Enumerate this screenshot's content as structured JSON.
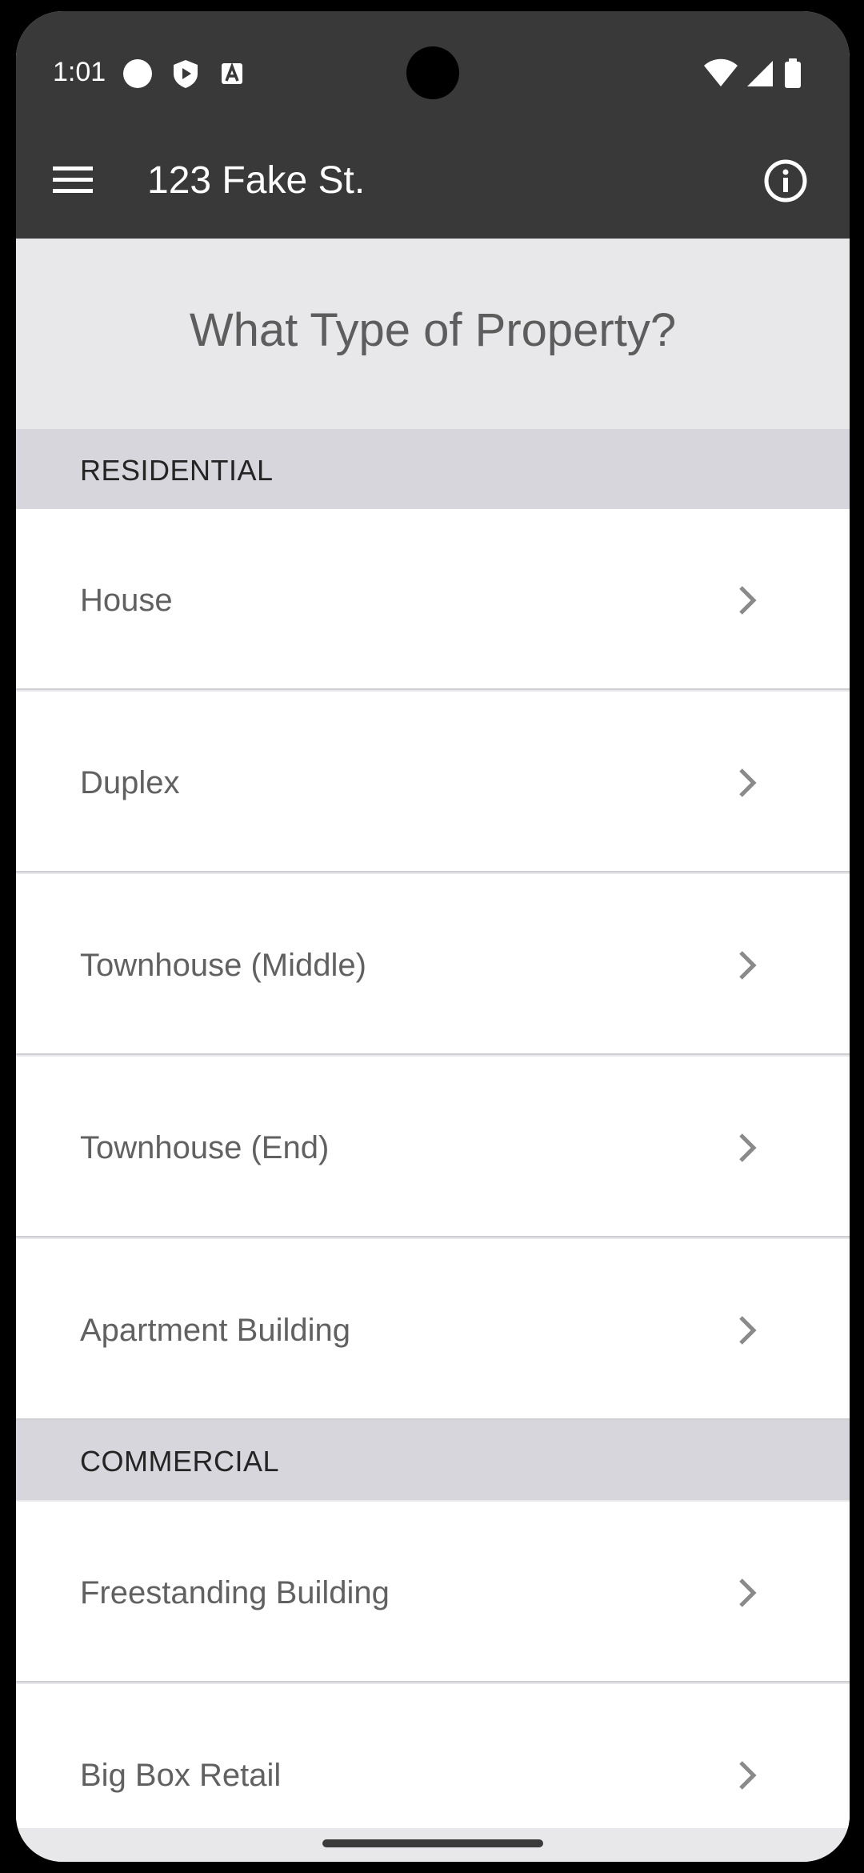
{
  "status_bar": {
    "time": "1:01",
    "icons": [
      "notification-dot-icon",
      "shield-play-icon",
      "a-badge-icon",
      "wifi-icon",
      "signal-icon",
      "battery-icon"
    ]
  },
  "app_bar": {
    "title": "123 Fake St.",
    "menu_icon": "hamburger-menu-icon",
    "info_icon": "info-icon"
  },
  "page": {
    "title": "What Type of Property?"
  },
  "sections": [
    {
      "label": "RESIDENTIAL",
      "items": [
        {
          "label": "House"
        },
        {
          "label": "Duplex"
        },
        {
          "label": "Townhouse (Middle)"
        },
        {
          "label": "Townhouse (End)"
        },
        {
          "label": "Apartment Building"
        }
      ]
    },
    {
      "label": "COMMERCIAL",
      "items": [
        {
          "label": "Freestanding Building"
        },
        {
          "label": "Big Box Retail"
        }
      ]
    }
  ],
  "colors": {
    "app_bar": "#393939",
    "background": "#e8e8ea",
    "section_header": "#d6d6dc",
    "row": "#ffffff",
    "row_text": "#616161",
    "chevron": "#8a8a8a"
  }
}
